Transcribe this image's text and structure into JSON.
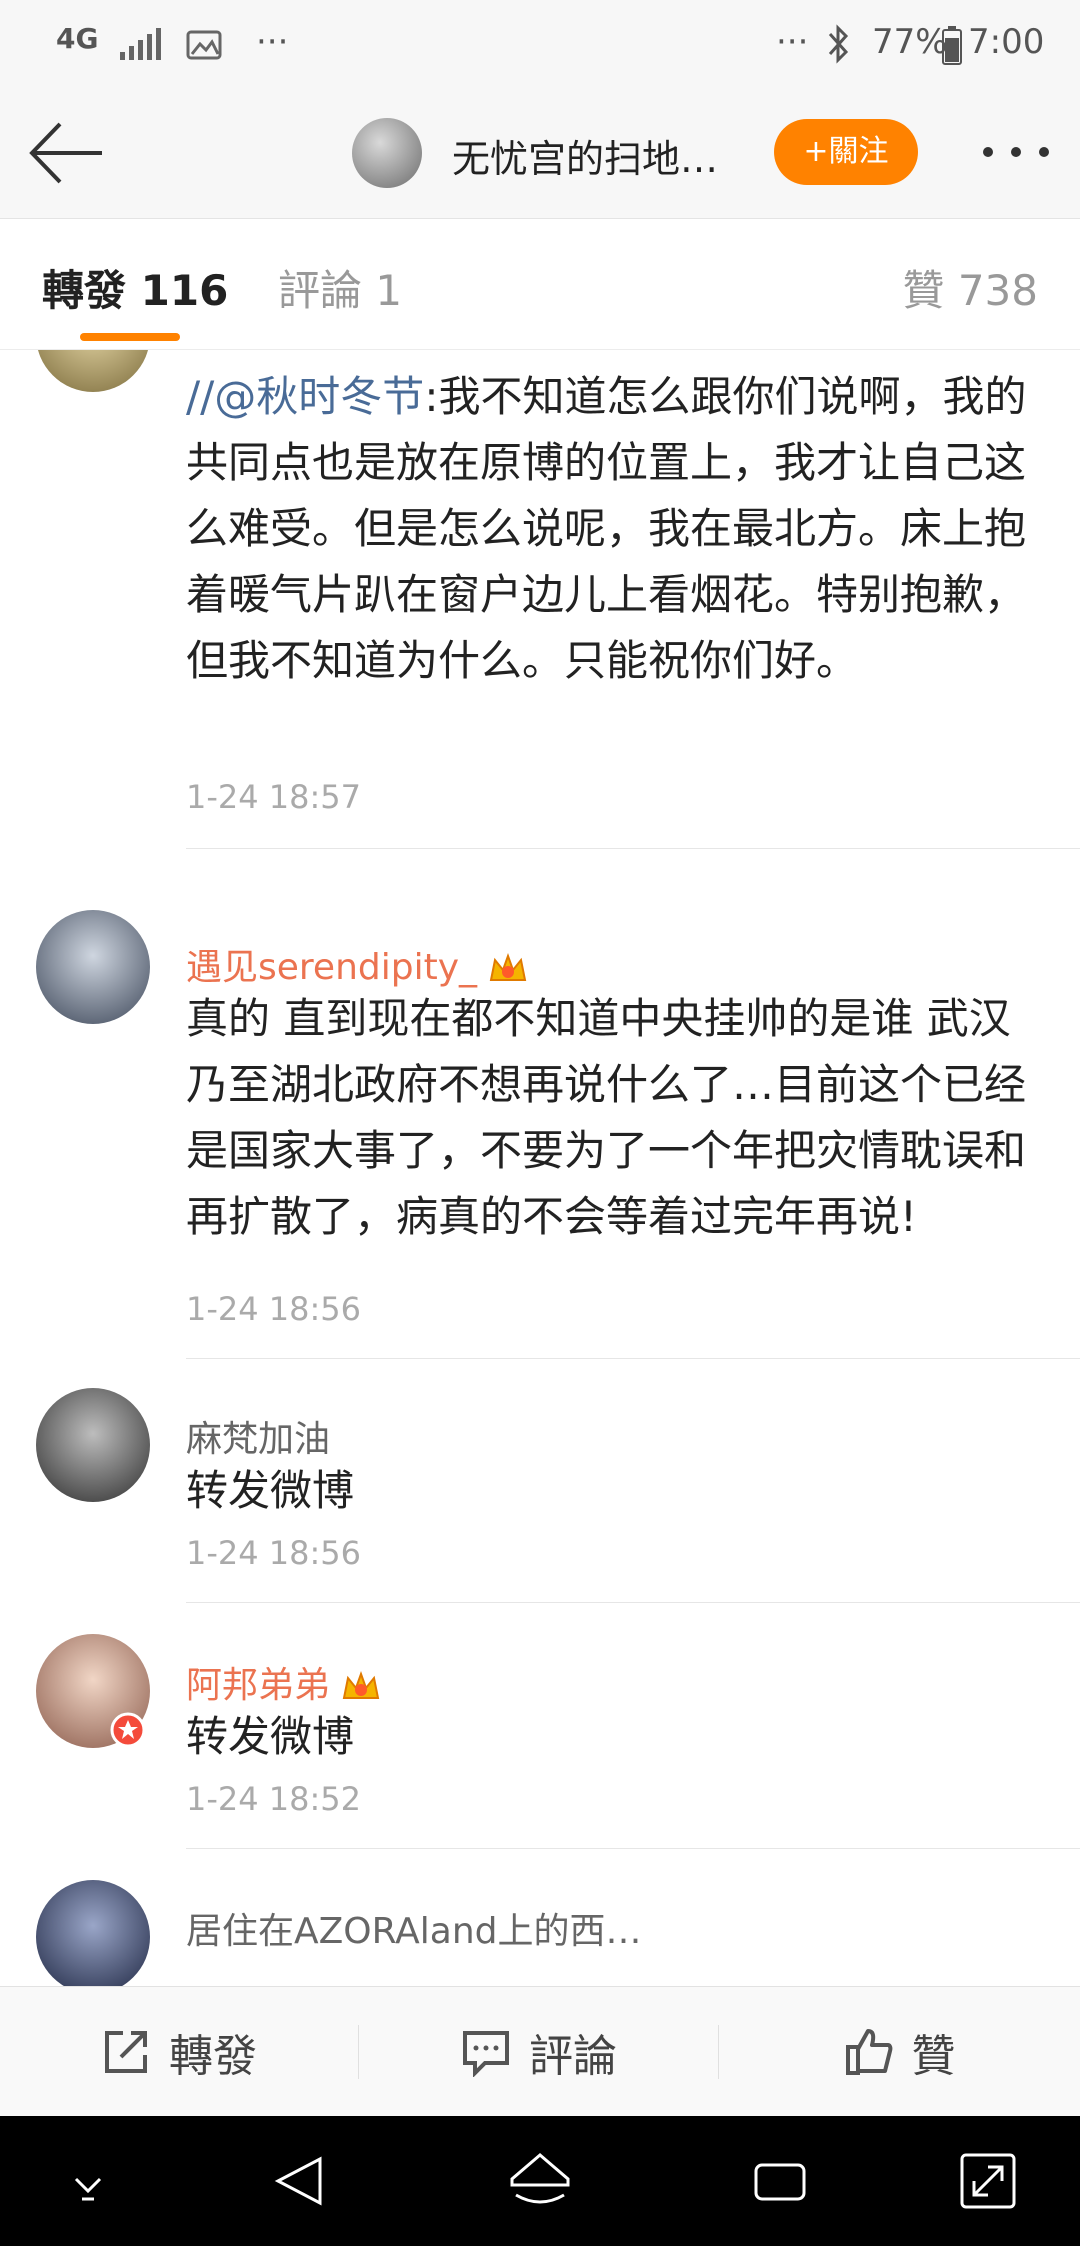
{
  "status_bar": {
    "network": "4G",
    "more_left": "···",
    "more_right": "···",
    "battery": "77%",
    "time": "7:00"
  },
  "header": {
    "title": "无忧宫的扫地…",
    "follow_label": "+關注"
  },
  "tabs": {
    "repost": "轉發 116",
    "comment": "評論 1",
    "like": "贊 738"
  },
  "comments": [
    {
      "mention": "//@秋时冬节",
      "text": ":我不知道怎么跟你们说啊，我的共同点也是放在原博的位置上，我才让自己这么难受。但是怎么说呢，我在最北方。床上抱着暖气片趴在窗户边儿上看烟花。特别抱歉，但我不知道为什么。只能祝你们好。",
      "time": "1-24 18:57"
    },
    {
      "user": "遇见serendipity_",
      "text": "真的 直到现在都不知道中央挂帅的是谁 武汉乃至湖北政府不想再说什么了…目前这个已经是国家大事了，不要为了一个年把灾情耽误和再扩散了，病真的不会等着过完年再说!",
      "time": "1-24 18:56"
    },
    {
      "user": "麻梵加油",
      "text": "转发微博",
      "time": "1-24 18:56"
    },
    {
      "user": "阿邦弟弟",
      "text": "转发微博",
      "time": "1-24 18:52"
    },
    {
      "user": "居住在AZORAland上的西…"
    }
  ],
  "actions": {
    "repost": "轉發",
    "comment": "評論",
    "like": "贊"
  },
  "colors": {
    "accent": "#ff8200",
    "vip_name": "#eb7350",
    "mention": "#496b97"
  }
}
